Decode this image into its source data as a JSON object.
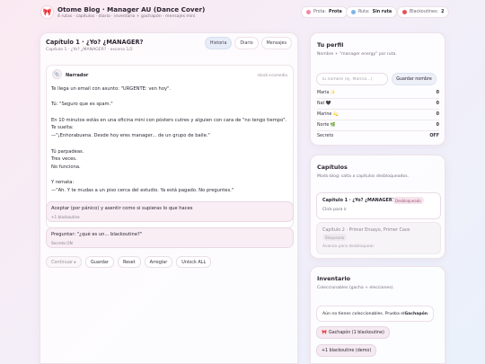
{
  "app": {
    "logo_glyph": "🎀",
    "title": "Otome Blog · Manager AU (Dance Cover)",
    "subtitle": "4 rutas · capítulos · diario · inventario + gachapón · mensajes mini"
  },
  "status": {
    "prota_label": "Prota:",
    "prota_value": "Prota",
    "ruta_label": "Ruta:",
    "ruta_value": "Sin ruta",
    "coins_label": "Blackoutines:",
    "coins_value": "2",
    "colors": {
      "prota": "#f08aa8",
      "ruta": "#7fb3e8",
      "coins": "#e5535a"
    }
  },
  "chapter": {
    "title": "Capítulo 1 · ¿Yo? ¿MANAGER?",
    "subtitle": "Capítulo 1 · ¿Yo? ¿MANAGER? · escena 1/2"
  },
  "tabs": [
    {
      "label": "Historia",
      "active": true
    },
    {
      "label": "Diario",
      "active": false
    },
    {
      "label": "Mensajes",
      "active": false
    }
  ],
  "message": {
    "speaker_icon": "📎",
    "speaker": "Narrador",
    "tag": "shock+comedia",
    "lines": [
      "Te llega un email con asunto: \"URGENTE: ven hoy\".",
      "",
      "Tú: \"Seguro que es spam.\"",
      "",
      "En 10 minutos estás en una oficina mini con pósters cutres y alguien con cara de \"no tengo tiempo\".",
      "Te suelta:",
      "—\"¡Enhorabuena. Desde hoy eres manager... de un grupo de baile.\"",
      "",
      "Tú parpadeas.",
      "Tres veces.",
      "No funciona.",
      "",
      "Y remata:",
      "—\"Ah. Y te mudas a un piso cerca del estudio. Ya está pagado. No preguntes.\""
    ]
  },
  "choices": [
    {
      "label": "Aceptar (por pánico) y asentir como si supieras lo que haces",
      "hint": "+1 blackoutine"
    },
    {
      "label": "Preguntar: \"¿qué es un... blackoutine?\"",
      "hint": "Secreto ON"
    }
  ],
  "actions": {
    "continue": "Continuar ▸",
    "save": "Guardar",
    "reset": "Reset",
    "arrange": "Arreglar",
    "unlock": "Unlock ALL"
  },
  "profile": {
    "title": "Tu perfil",
    "subtitle": "Nombre + \"manager energy\" por ruta.",
    "input_placeholder": "Tu nombre (ej. Marina…)",
    "save_button": "Guardar nombre",
    "affinities": [
      {
        "name": "Maria ✨",
        "value": "0"
      },
      {
        "name": "Nat 🖤",
        "value": "0"
      },
      {
        "name": "Marine 💫",
        "value": "0"
      },
      {
        "name": "Norte 🌿",
        "value": "0"
      },
      {
        "name": "Secreto",
        "value": "OFF"
      }
    ]
  },
  "chapters_panel": {
    "title": "Capítulos",
    "subtitle": "Modo blog: salta a capítulos desbloqueados.",
    "items": [
      {
        "name": "Capítulo 1 · ¿Yo? ¿MANAGER?",
        "badge": "Desbloqueado",
        "hint": "Click para ir",
        "unlocked": true
      },
      {
        "name": "Capítulo 2 · Primer Ensayo, Primer Caos",
        "badge": "Bloqueado",
        "hint": "Avanza para desbloquear.",
        "unlocked": false
      }
    ]
  },
  "inventory": {
    "title": "Inventario",
    "subtitle": "Coleccionables (gacha + elecciones).",
    "empty_prefix": "Aún no tienes coleccionables. Prueba el ",
    "empty_strong": "Gachapón",
    "empty_suffix": ".",
    "gacha_icon": "🎀",
    "gacha_button": "Gachapón (1 blackoutine)",
    "demo_button": "+1 blackoutine (demo)"
  }
}
